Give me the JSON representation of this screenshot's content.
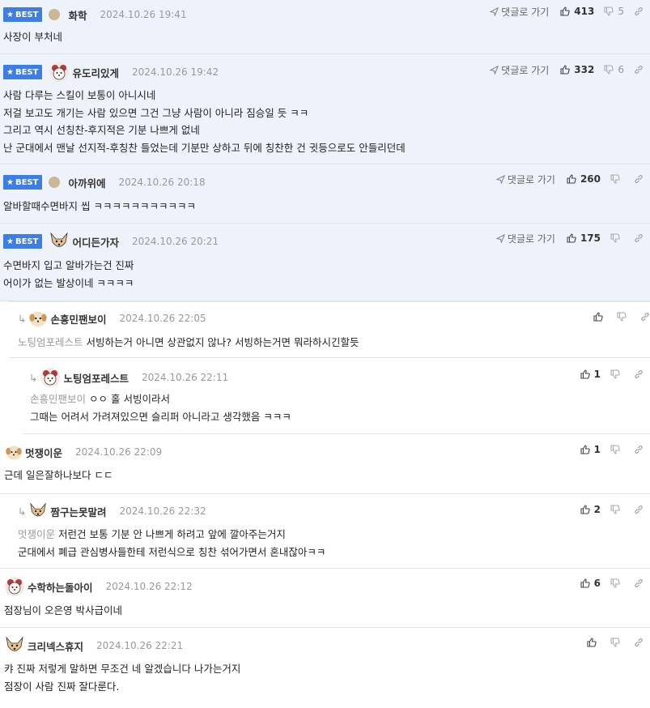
{
  "ui": {
    "best_label": "BEST",
    "reply_link": "댓글로 가기"
  },
  "comments": [
    {
      "nick": "화학",
      "date": "2024.10.26 19:41",
      "likes": "413",
      "dislikes": "5",
      "lines": [
        "사장이 부처네"
      ]
    },
    {
      "nick": "유도리있게",
      "date": "2024.10.26 19:42",
      "likes": "332",
      "dislikes": "6",
      "lines": [
        "사람 다루는 스킬이 보통이 아니시네",
        "저걸 보고도 개기는 사람 있으면 그건 그냥 사람이 아니라 짐승일 듯 ㅋㅋ",
        "그리고 역시 선칭찬-후지적은 기분 나쁘게 없네",
        "난 군대에서 맨날 선지적-후칭찬 들었는데 기분만 상하고 뒤에 칭찬한 건 귓등으로도 안들리던데"
      ]
    },
    {
      "nick": "아까위에",
      "date": "2024.10.26 20:18",
      "likes": "260",
      "dislikes": "",
      "lines": [
        "알바할때수면바지 씹 ㅋㅋㅋㅋㅋㅋㅋㅋㅋㅋㅋ"
      ]
    },
    {
      "nick": "어디든가자",
      "date": "2024.10.26 20:21",
      "likes": "175",
      "dislikes": "",
      "lines": [
        "수면바지 입고 알바가는건 진짜",
        "어이가 없는 발상이네 ㅋㅋㅋㅋ"
      ]
    },
    {
      "nick": "손흥민팬보이",
      "date": "2024.10.26 22:05",
      "likes": "",
      "dislikes": "",
      "mention": "노팅엄포레스트",
      "lines": [
        "서빙하는거 아니면 상관없지 않나? 서빙하는거면 뭐라하시긴할듯"
      ]
    },
    {
      "nick": "노팅엄포레스트",
      "date": "2024.10.26 22:11",
      "likes": "1",
      "dislikes": "",
      "mention": "손흥민팬보이",
      "lines": [
        "ㅇㅇ 홀 서빙이라서",
        "그때는 어려서 가려져있으면 슬리퍼 아니라고 생각했음 ㅋㅋㅋ"
      ]
    },
    {
      "nick": "멋쟁이운",
      "date": "2024.10.26 22:09",
      "likes": "1",
      "dislikes": "",
      "lines": [
        "근데 일은잘하나보다 ㄷㄷ"
      ]
    },
    {
      "nick": "짬구는못말려",
      "date": "2024.10.26 22:32",
      "likes": "2",
      "dislikes": "",
      "mention": "멋쟁이운",
      "lines": [
        "저런건 보통 기분 안 나쁘게 하려고 앞에 깔아주는거지",
        "군대에서 폐급 관심병사들한테 저런식으로 칭찬 섞어가면서 혼내잖아ㅋㅋ"
      ]
    },
    {
      "nick": "수학하는돌아이",
      "date": "2024.10.26 22:12",
      "likes": "6",
      "dislikes": "",
      "lines": [
        "점장님이 오은영 박사급이네"
      ]
    },
    {
      "nick": "크리넥스휴지",
      "date": "2024.10.26 22:21",
      "likes": "",
      "dislikes": "",
      "lines": [
        "캬 진짜 저렇게 말하면 무조건 네 알겠습니다 나가는거지",
        "점장이 사람 진짜 잘다룬다."
      ]
    }
  ]
}
